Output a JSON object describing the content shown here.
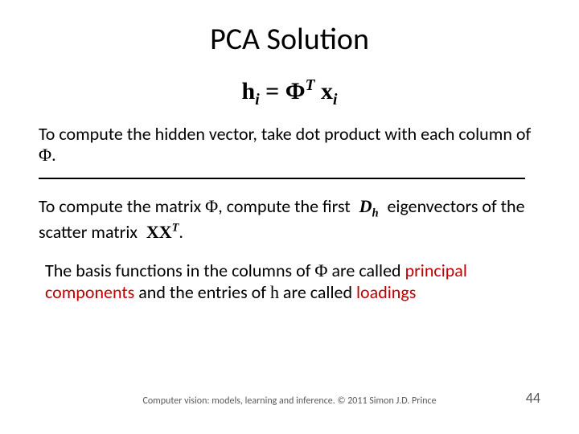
{
  "title": "PCA Solution",
  "equation": {
    "h": "h",
    "hi_sub": "i",
    "eq": " = ",
    "phi": "Φ",
    "phi_sup": "T",
    "x": "x",
    "xi_sub": "i"
  },
  "para1_a": "To compute the hidden vector, take dot product with each column of ",
  "para1_phi": "Φ",
  "para1_b": ".",
  "para2_a": "To compute the matrix ",
  "para2_phi": "Φ",
  "para2_b": ", compute the first ",
  "para2_Dh_D": "D",
  "para2_Dh_h": "h",
  "para2_c": " eigenvectors of the scatter matrix ",
  "para2_XXT_X1": "X",
  "para2_XXT_X2": "X",
  "para2_XXT_T": "T",
  "para2_d": ".",
  "para3_a": "The basis functions in the columns of ",
  "para3_phi": "Φ",
  "para3_b": " are called ",
  "para3_pc": "principal components",
  "para3_c": " and the entries of ",
  "para3_h": "h",
  "para3_d": " are called ",
  "para3_load": "loadings",
  "footer": "Computer vision: models, learning and inference.   © 2011 Simon J.D. Prince",
  "pagenum": "44"
}
